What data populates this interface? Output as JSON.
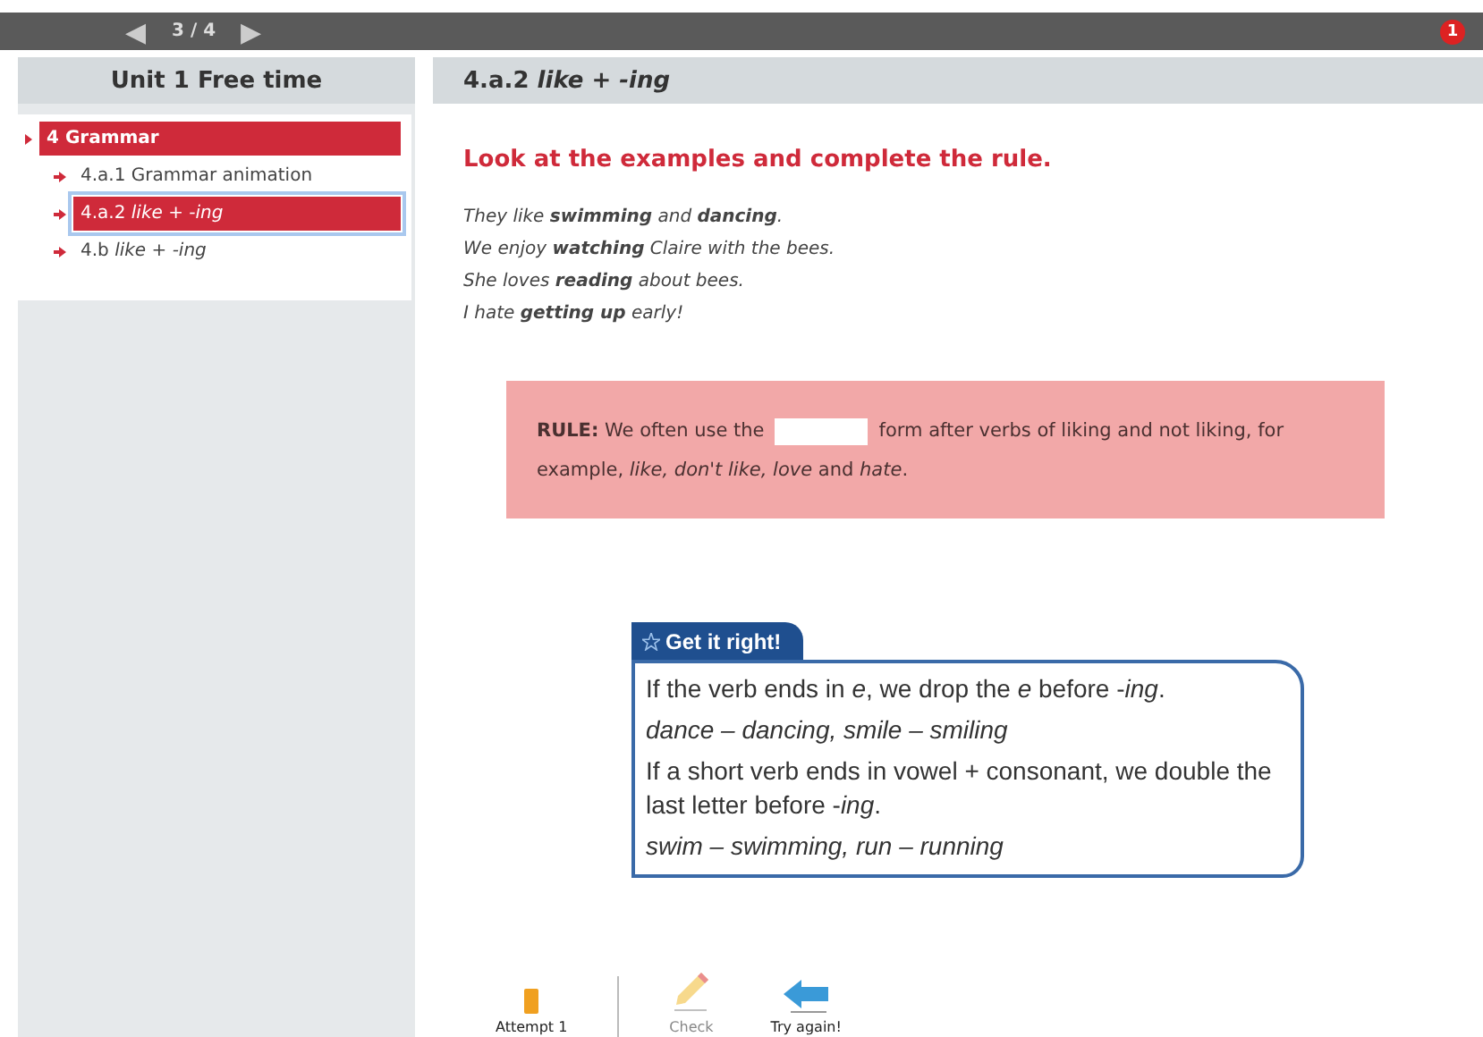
{
  "topbar": {
    "prev": "◀",
    "page": "3 / 4",
    "next": "▶",
    "badge": "1"
  },
  "sidebar": {
    "title": "Unit 1 Free time",
    "items": [
      {
        "kind": "section",
        "label": "4 Grammar",
        "selected": false,
        "children": [
          {
            "kind": "item",
            "label": "4.a.1 Grammar animation",
            "selected": false
          },
          {
            "kind": "item",
            "label": "4.a.2 *like + -ing*",
            "selected": true
          },
          {
            "kind": "item",
            "label": "4.b *like + -ing*",
            "selected": false
          }
        ]
      }
    ]
  },
  "content": {
    "title": "4.a.2 *like + -ing*",
    "instruction": "Look at the examples and complete the rule.",
    "examples": [
      "They like **swimming** and **dancing**.",
      "We enjoy **watching** Claire with the bees.",
      "She loves **reading** about bees.",
      "I hate **getting up** early!"
    ],
    "rule": {
      "before": "**RULE:** We often use the",
      "after": "form after verbs of liking and not liking, for",
      "continuation": "example, *like, don't like, love* and *hate*."
    },
    "tip": {
      "title": "Get it right!",
      "lines": [
        "If the verb ends in *e*, we drop the *e* before -*ing*.",
        "*dance – dancing, smile – smiling*",
        "If a short verb ends in vowel + consonant, we double the last letter before -*ing*.",
        "*swim – swimming, run – running*"
      ]
    },
    "footer": {
      "attempt": "Attempt 1",
      "check": {
        "label": "Check",
        "disabled": true
      },
      "retry": {
        "label": "Try again!",
        "disabled": false
      }
    }
  }
}
